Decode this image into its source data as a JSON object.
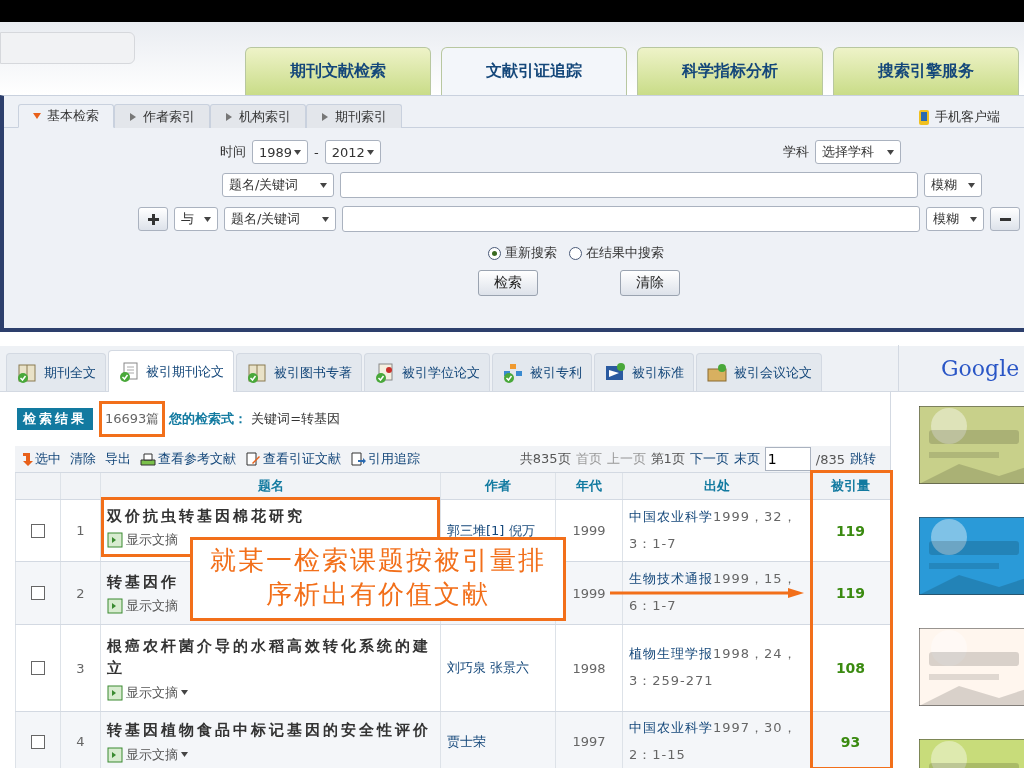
{
  "top_tabs": [
    {
      "label": "期刊文献检索",
      "selected": false
    },
    {
      "label": "文献引证追踪",
      "selected": true
    },
    {
      "label": "科学指标分析",
      "selected": false
    },
    {
      "label": "搜索引擎服务",
      "selected": false
    }
  ],
  "search_tabs": [
    {
      "label": "基本检索",
      "selected": true
    },
    {
      "label": "作者索引",
      "selected": false
    },
    {
      "label": "机构索引",
      "selected": false
    },
    {
      "label": "期刊索引",
      "selected": false
    }
  ],
  "mobile_link": "手机客户端",
  "time_label": "时间",
  "year_from": "1989",
  "dash": "-",
  "year_to": "2012",
  "subject_label": "学科",
  "subject_select": "选择学科",
  "query_rows": [
    {
      "kind": "first",
      "field": "题名/关键词",
      "match": "模糊"
    },
    {
      "kind": "extra",
      "logic": "与",
      "field": "题名/关键词",
      "match": "模糊"
    }
  ],
  "scope_options": [
    {
      "label": "重新搜索",
      "selected": true
    },
    {
      "label": "在结果中搜索",
      "selected": false
    }
  ],
  "buttons": [
    "检索",
    "清除"
  ],
  "result_tabs": [
    {
      "label": "期刊全文",
      "selected": false,
      "kind": "book"
    },
    {
      "label": "被引期刊论文",
      "selected": true,
      "kind": "doc"
    },
    {
      "label": "被引图书专著",
      "selected": false,
      "kind": "book"
    },
    {
      "label": "被引学位论文",
      "selected": false,
      "kind": "award"
    },
    {
      "label": "被引专利",
      "selected": false,
      "kind": "blocks"
    },
    {
      "label": "被引标准",
      "selected": false,
      "kind": "standard"
    },
    {
      "label": "被引会议论文",
      "selected": false,
      "kind": "box"
    }
  ],
  "google": "Google",
  "result_label": "检索结果",
  "count": "16693篇",
  "query_label": "您的检索式：",
  "query": "关键词=转基因",
  "toolbar": [
    {
      "label": "选中",
      "kind": "select"
    },
    {
      "label": "清除",
      "kind": "none"
    },
    {
      "label": "导出",
      "kind": "none"
    },
    {
      "label": "查看参考文献",
      "kind": "ref"
    },
    {
      "label": "查看引证文献",
      "kind": "cite"
    },
    {
      "label": "引用追踪",
      "kind": "track"
    }
  ],
  "pager": {
    "total": "共835页",
    "first": "首页",
    "prev": "上一页",
    "current": "第1页",
    "next": "下一页",
    "last": "末页",
    "page": "1",
    "of": "/835",
    "go": "跳转"
  },
  "table": {
    "columns": [
      "题名",
      "作者",
      "年代",
      "出处",
      "被引量"
    ],
    "rows": [
      {
        "checked": false,
        "index": "1",
        "highlighted": true,
        "title": "双价抗虫转基因棉花研究",
        "abstract": "显示文摘",
        "show_caret": false,
        "authors": "郭三堆[1] 倪万",
        "year": "1999",
        "journal": "中国农业科学",
        "source": [
          "1999，32，",
          "3：1-7"
        ],
        "cited": "119"
      },
      {
        "checked": false,
        "index": "2",
        "highlighted": false,
        "title": "转基因作",
        "abstract": "显示文摘",
        "show_caret": false,
        "year": "1999",
        "journal": "生物技术通报",
        "source": [
          "1999，15，",
          "6：1-7"
        ],
        "cited": "119"
      },
      {
        "checked": false,
        "index": "3",
        "highlighted": false,
        "title": "根癌农杆菌介导的水稻高效转化系统的建立",
        "abstract": "显示文摘",
        "show_caret": true,
        "authors": "刘巧泉 张景六",
        "year": "1998",
        "journal": "植物生理学报",
        "source": [
          "1998，24，",
          "3：259-271"
        ],
        "cited": "108"
      },
      {
        "checked": false,
        "index": "4",
        "highlighted": false,
        "title": "转基因植物食品中标记基因的安全性评价",
        "abstract": "显示文摘",
        "show_caret": true,
        "authors": "贾士荣",
        "year": "1997",
        "journal": "中国农业科学",
        "source": [
          "1997，30，",
          "2：1-15"
        ],
        "cited": "93"
      }
    ]
  },
  "callout": "就某一检索课题按被引量排序析出有价值文献"
}
